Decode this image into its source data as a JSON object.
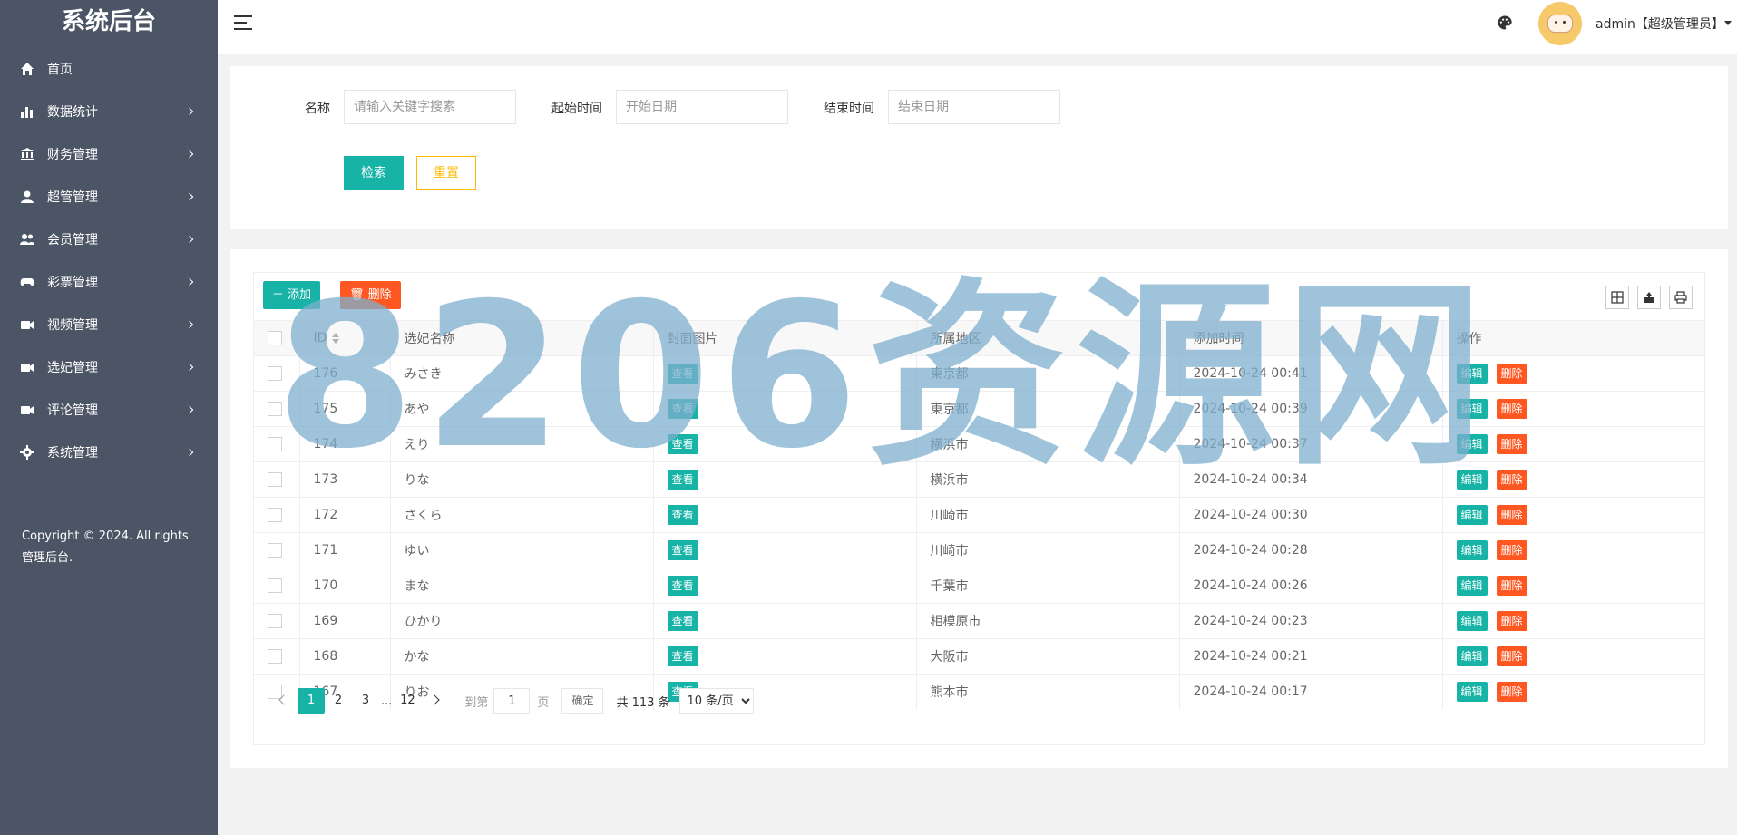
{
  "sidebar": {
    "title": "系统后台",
    "items": [
      {
        "label": "首页",
        "icon": "home-icon",
        "has_arrow": false
      },
      {
        "label": "数据统计",
        "icon": "bar-chart-icon",
        "has_arrow": true
      },
      {
        "label": "财务管理",
        "icon": "bank-icon",
        "has_arrow": true
      },
      {
        "label": "超管管理",
        "icon": "user-icon",
        "has_arrow": true
      },
      {
        "label": "会员管理",
        "icon": "users-icon",
        "has_arrow": true
      },
      {
        "label": "彩票管理",
        "icon": "gamepad-icon",
        "has_arrow": true
      },
      {
        "label": "视频管理",
        "icon": "video-icon",
        "has_arrow": true
      },
      {
        "label": "选妃管理",
        "icon": "video-icon",
        "has_arrow": true
      },
      {
        "label": "评论管理",
        "icon": "video-icon",
        "has_arrow": true
      },
      {
        "label": "系统管理",
        "icon": "gear-icon",
        "has_arrow": true
      }
    ],
    "copyright": "Copyright © 2024. All rights 管理后台."
  },
  "header": {
    "user_name": "admin【超级管理员】"
  },
  "search": {
    "name_label": "名称",
    "name_placeholder": "请输入关键字搜索",
    "start_label": "起始时间",
    "start_placeholder": "开始日期",
    "end_label": "结束时间",
    "end_placeholder": "结束日期",
    "search_button": "检索",
    "reset_button": "重置"
  },
  "toolbar": {
    "add_label": "添加",
    "delete_label": "删除"
  },
  "table": {
    "columns": [
      "ID",
      "选妃名称",
      "封面图片",
      "所属地区",
      "添加时间",
      "操作"
    ],
    "view_label": "查看",
    "edit_label": "编辑",
    "delete_label": "删除",
    "rows": [
      {
        "id": "176",
        "name": "みさき",
        "region": "東京都",
        "time": "2024-10-24 00:41"
      },
      {
        "id": "175",
        "name": "あや",
        "region": "東京都",
        "time": "2024-10-24 00:39"
      },
      {
        "id": "174",
        "name": "えり",
        "region": "横浜市",
        "time": "2024-10-24 00:37"
      },
      {
        "id": "173",
        "name": "りな",
        "region": "横浜市",
        "time": "2024-10-24 00:34"
      },
      {
        "id": "172",
        "name": "さくら",
        "region": "川崎市",
        "time": "2024-10-24 00:30"
      },
      {
        "id": "171",
        "name": "ゆい",
        "region": "川崎市",
        "time": "2024-10-24 00:28"
      },
      {
        "id": "170",
        "name": "まな",
        "region": "千葉市",
        "time": "2024-10-24 00:26"
      },
      {
        "id": "169",
        "name": "ひかり",
        "region": "相模原市",
        "time": "2024-10-24 00:23"
      },
      {
        "id": "168",
        "name": "かな",
        "region": "大阪市",
        "time": "2024-10-24 00:21"
      },
      {
        "id": "167",
        "name": "りお",
        "region": "熊本市",
        "time": "2024-10-24 00:17"
      }
    ]
  },
  "pagination": {
    "pages": [
      "1",
      "2",
      "3"
    ],
    "ellipsis": "...",
    "last_page": "12",
    "current": "1",
    "goto_label": "到第",
    "goto_value": "1",
    "page_unit": "页",
    "confirm_label": "确定",
    "total_text": "共 113 条",
    "limit_option": "10 条/页"
  },
  "watermark": "8206资源网",
  "colors": {
    "primary": "#16b3a6",
    "danger": "#ff5722",
    "warning": "#ffb800",
    "sidebar_bg": "#4b5565"
  }
}
